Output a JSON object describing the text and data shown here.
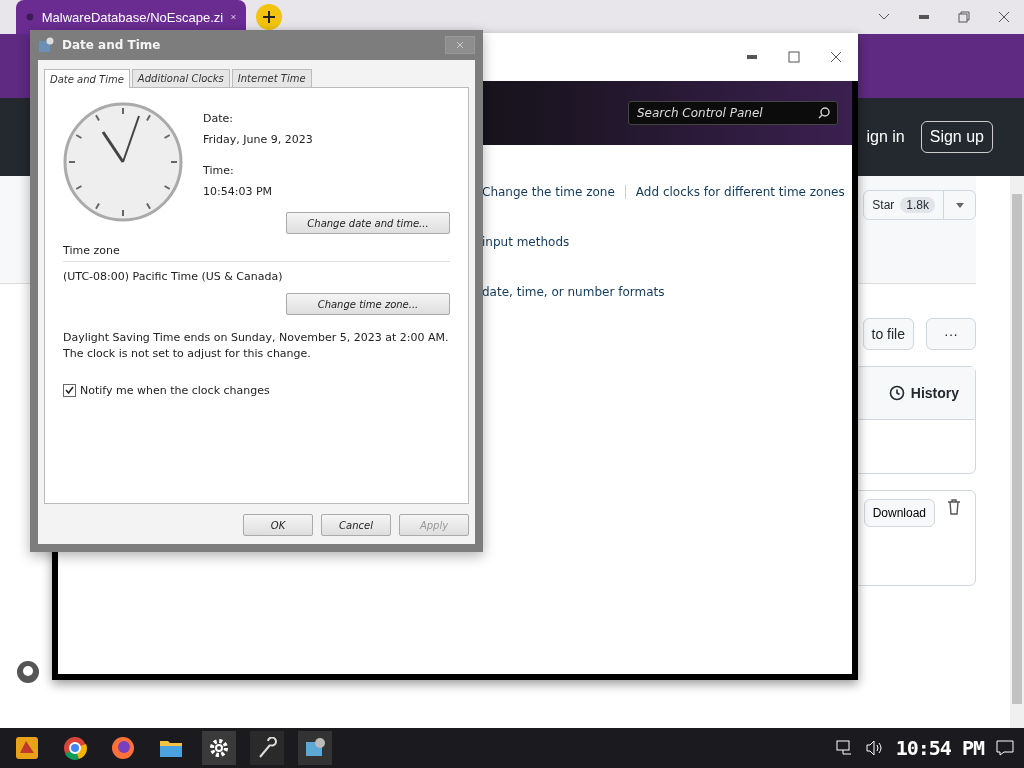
{
  "browser": {
    "tab": {
      "title": "MalwareDatabase/NoEscape.zi",
      "selected": true
    },
    "github": {
      "sign_in": "ign in",
      "sign_up": "Sign up",
      "star": "Star",
      "star_count": "1.8k",
      "go_to_file": "to file",
      "more": "···",
      "history": "History",
      "download": "Download"
    }
  },
  "control_panel": {
    "search": {
      "placeholder": "Search Control Panel"
    },
    "link_rows": [
      [
        "Change the time zone",
        "Add clocks for different time zones"
      ],
      [
        "input methods"
      ],
      [
        "date, time, or number formats"
      ]
    ]
  },
  "dialog": {
    "title": "Date and Time",
    "tabs": [
      {
        "label": "Date and Time",
        "selected": true
      },
      {
        "label": "Additional Clocks",
        "selected": false
      },
      {
        "label": "Internet Time",
        "selected": false
      }
    ],
    "date_label": "Date:",
    "date": "Friday, June 9, 2023",
    "time_label": "Time:",
    "time": "10:54:03 PM",
    "change_button": "Change date and time...",
    "zone_label": "Time zone",
    "zone": "(UTC-08:00) Pacific Time (US & Canada)",
    "zone_button": "Change time zone...",
    "dst_lines": [
      "Daylight Saving Time ends on Sunday, November 5, 2023 at 2:00 AM.",
      "The clock is not set to adjust for this change."
    ],
    "notify": {
      "label": "Notify me when the clock changes",
      "checked": true
    },
    "buttons": [
      {
        "label": "OK",
        "disabled": false
      },
      {
        "label": "Cancel",
        "disabled": false
      },
      {
        "label": "Apply",
        "disabled": true
      }
    ]
  },
  "taskbar": {
    "clock": "10:54 PM"
  }
}
